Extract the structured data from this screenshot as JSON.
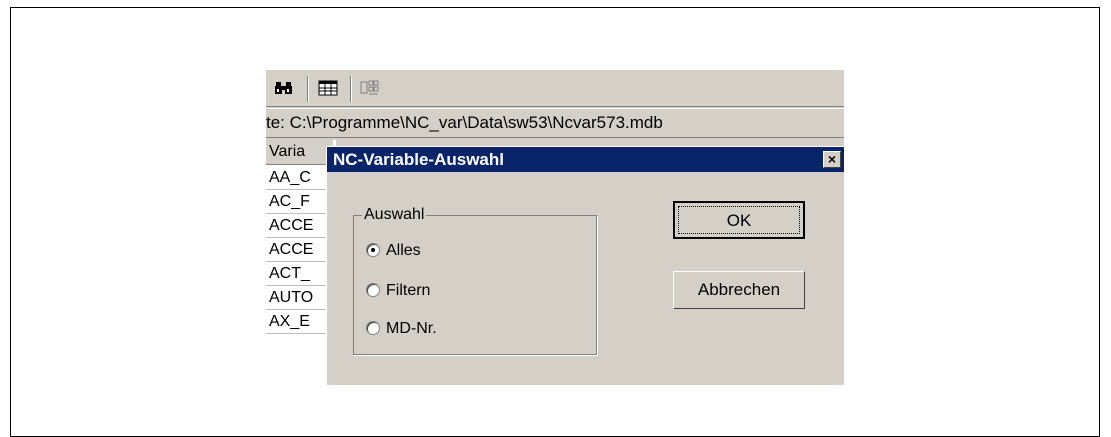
{
  "path_bar": {
    "text": "te: C:\\Programme\\NC_var\\Data\\sw53\\Ncvar573.mdb"
  },
  "list": {
    "header": "Varia",
    "items": [
      "AA_C",
      "AC_F",
      "ACCE",
      "ACCE",
      "ACT_",
      "AUTO",
      "AX_E"
    ]
  },
  "dialog": {
    "title": "NC-Variable-Auswahl",
    "close_glyph": "×",
    "group_label": "Auswahl",
    "options": [
      {
        "label": "Alles",
        "checked": true
      },
      {
        "label": "Filtern",
        "checked": false
      },
      {
        "label": "MD-Nr.",
        "checked": false
      }
    ],
    "ok_label": "OK",
    "cancel_label": "Abbrechen"
  },
  "toolbar": {
    "icons": [
      "binoculars-icon",
      "table-icon",
      "filter-icon"
    ]
  }
}
